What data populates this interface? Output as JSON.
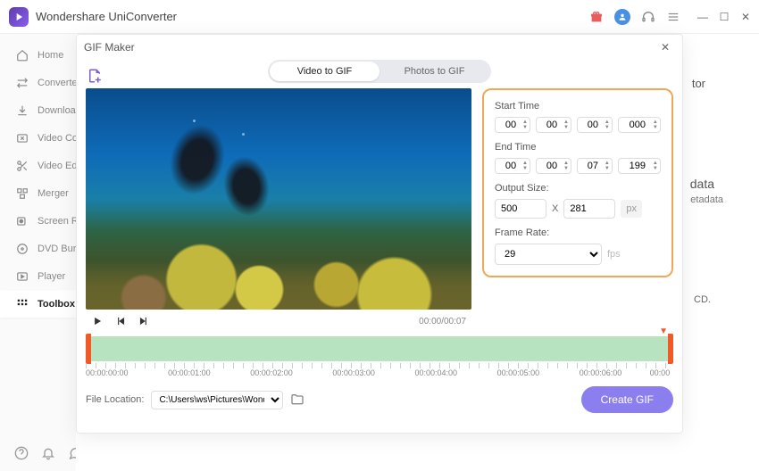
{
  "app": {
    "title": "Wondershare UniConverter"
  },
  "sidebar": {
    "items": [
      {
        "label": "Home"
      },
      {
        "label": "Converter"
      },
      {
        "label": "Downloader"
      },
      {
        "label": "Video Compressor"
      },
      {
        "label": "Video Editor"
      },
      {
        "label": "Merger"
      },
      {
        "label": "Screen Recorder"
      },
      {
        "label": "DVD Burner"
      },
      {
        "label": "Player"
      },
      {
        "label": "Toolbox"
      }
    ]
  },
  "bg": {
    "tor": "tor",
    "data": "data",
    "etadata": "etadata",
    "cd": "CD."
  },
  "modal": {
    "title": "GIF Maker",
    "tabs": {
      "video": "Video to GIF",
      "photos": "Photos to GIF"
    },
    "playtime": "00:00/00:07",
    "settings": {
      "start_label": "Start Time",
      "end_label": "End Time",
      "start": {
        "h": "00",
        "m": "00",
        "s": "00",
        "ms": "000"
      },
      "end": {
        "h": "00",
        "m": "00",
        "s": "07",
        "ms": "199"
      },
      "output_label": "Output Size:",
      "width": "500",
      "height": "281",
      "x": "X",
      "px": "px",
      "framerate_label": "Frame Rate:",
      "framerate": "29",
      "fps": "fps"
    },
    "timeline": {
      "ticks": [
        "00:00:00:00",
        "00:00:01:00",
        "00:00:02:00",
        "00:00:03:00",
        "00:00:04:00",
        "00:00:05:00",
        "00:00:06:00",
        "00:00"
      ]
    },
    "footer": {
      "label": "File Location:",
      "path": "C:\\Users\\ws\\Pictures\\Wonders",
      "create": "Create GIF"
    }
  }
}
